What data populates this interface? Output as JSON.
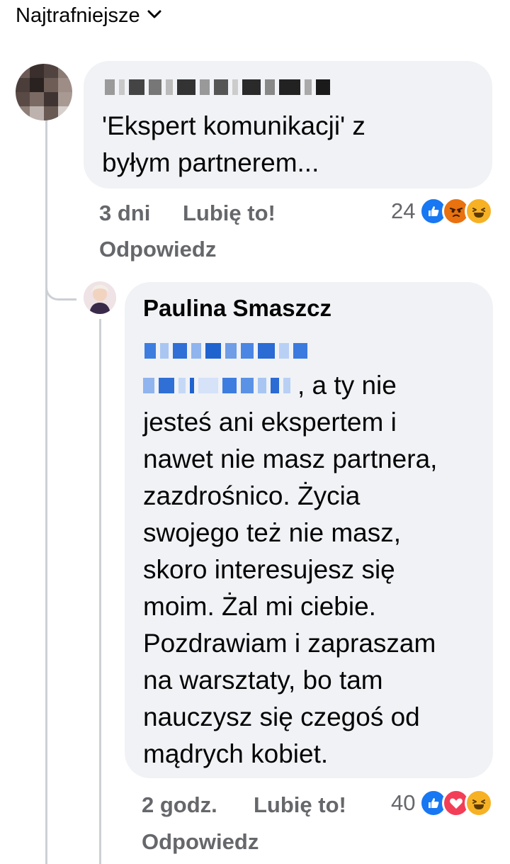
{
  "sort": {
    "label": "Najtrafniejsze"
  },
  "comments": [
    {
      "author": "",
      "text": "'Ekspert komunikacji' z byłym partnerem...",
      "text_lines": [
        "'Ekspert komunikacji' z",
        "byłym partnerem..."
      ],
      "time": "3 dni",
      "like_label": "Lubię to!",
      "reply_label": "Odpowiedz",
      "reaction_count": "24",
      "reactions": [
        "like-icon",
        "angry-icon",
        "haha-icon"
      ]
    },
    {
      "author": "Paulina Smaszcz",
      "text_lines": [
        ", a ty nie",
        "jesteś ani ekspertem i",
        "nawet nie masz partnera,",
        "zazdrośnico. Życia",
        "swojego też nie masz,",
        "skoro interesujesz się",
        "moim. Żal mi ciebie.",
        "Pozdrawiam i zapraszam",
        "na warsztaty, bo tam",
        "nauczysz się czegoś od",
        "mądrych kobiet."
      ],
      "time": "2 godz.",
      "like_label": "Lubię to!",
      "reply_label": "Odpowiedz",
      "reaction_count": "40",
      "reactions": [
        "like-icon",
        "love-icon",
        "haha-icon"
      ]
    }
  ],
  "colors": {
    "bubble": "#f0f2f5",
    "meta_text": "#65676b",
    "like_blue": "#1877f2",
    "love_red": "#f33e58",
    "haha_yellow": "#f7b125",
    "angry_orange": "#e9710f"
  }
}
